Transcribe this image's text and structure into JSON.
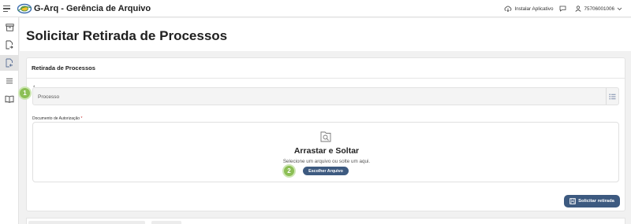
{
  "app": {
    "title": "G-Arq - Gerência de Arquivo"
  },
  "topbar": {
    "install_label": "Instalar Aplicativo",
    "user_id": "75706001006"
  },
  "page": {
    "title": "Solicitar Retirada de Processos"
  },
  "card": {
    "title": "Retirada de Processos",
    "process_field": {
      "asterisk": "*",
      "placeholder": "Processo"
    },
    "document": {
      "label": "Documento de Autorização",
      "required_mark": "*",
      "dropzone_title": "Arrastar e Soltar",
      "dropzone_sub": "Selecione um arquivo ou solte um aqui.",
      "choose_label": "Escolher Arquivo"
    },
    "submit_label": "Solicitar retirada"
  },
  "badges": [
    "1",
    "2"
  ],
  "colors": {
    "primary": "#3d5a80",
    "badge": "#8cbf55",
    "required": "#c62828"
  },
  "icons": {
    "rail": [
      "archive-icon",
      "document-arrow-icon",
      "document-export-icon",
      "list-icon",
      "book-icon"
    ],
    "top": [
      "menu-icon",
      "cloud-download-icon",
      "chat-icon",
      "user-icon",
      "chevron-down-icon"
    ]
  }
}
